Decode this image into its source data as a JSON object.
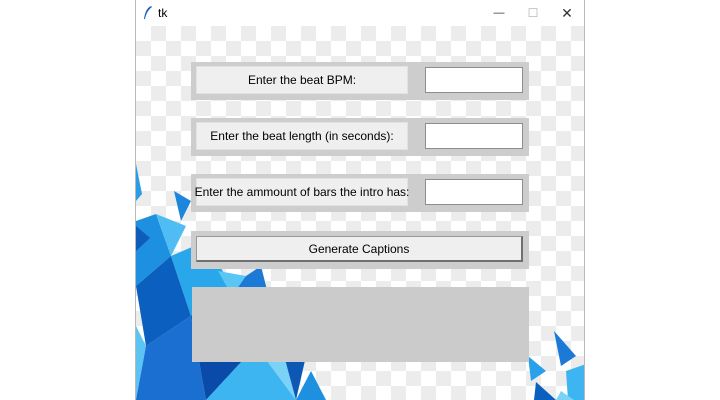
{
  "window": {
    "title": "tk",
    "icons": {
      "app": "feather-icon",
      "minimize": "minimize-icon",
      "maximize": "maximize-icon",
      "close": "close-icon"
    },
    "glyphs": {
      "minimize": "—",
      "maximize": "☐",
      "close": "✕"
    }
  },
  "form": {
    "bpm_label": "Enter the beat BPM:",
    "bpm_value": "",
    "length_label": "Enter the beat length (in seconds):",
    "length_value": "",
    "bars_label": "Enter the ammount of bars the intro has:",
    "bars_value": ""
  },
  "generate_button": "Generate Captions",
  "output_text": "",
  "colors": {
    "accent_blue": "#1f8fe0",
    "dark_blue": "#0b4fae",
    "panel_gray": "#cdcdcd"
  }
}
